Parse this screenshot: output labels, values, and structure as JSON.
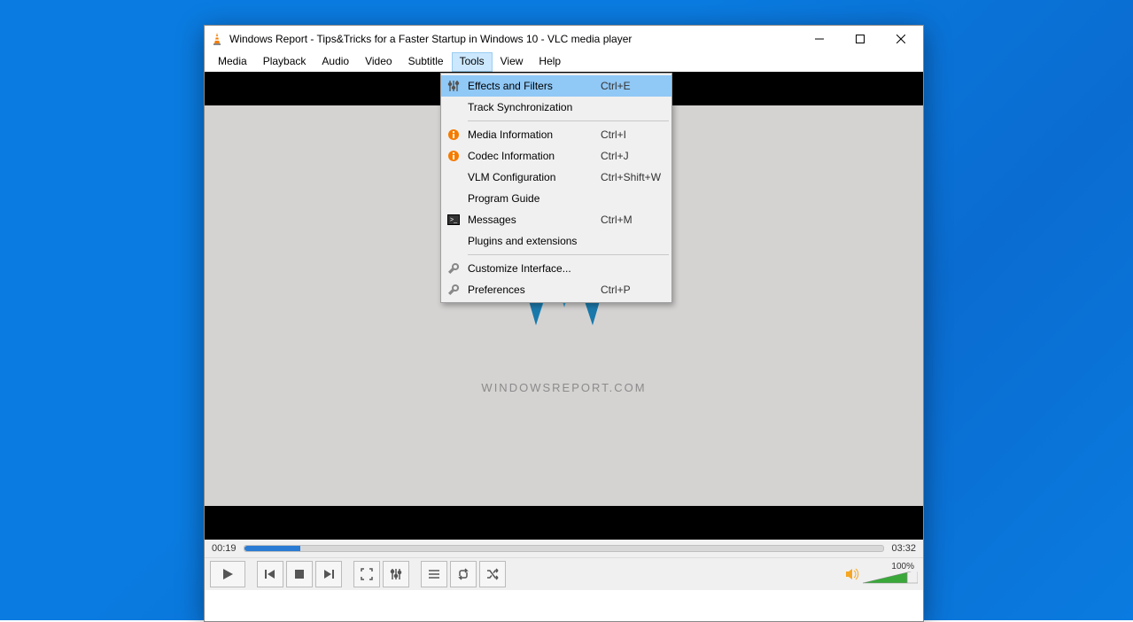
{
  "window": {
    "title": "Windows Report - Tips&Tricks for a Faster Startup in Windows 10 - VLC media player"
  },
  "menubar": [
    "Media",
    "Playback",
    "Audio",
    "Video",
    "Subtitle",
    "Tools",
    "View",
    "Help"
  ],
  "menubar_open_index": 5,
  "tools_menu": [
    {
      "icon": "sliders",
      "label": "Effects and Filters",
      "shortcut": "Ctrl+E",
      "highlight": true
    },
    {
      "icon": "",
      "label": "Track Synchronization",
      "shortcut": ""
    },
    {
      "sep": true
    },
    {
      "icon": "info",
      "label": "Media Information",
      "shortcut": "Ctrl+I"
    },
    {
      "icon": "info",
      "label": "Codec Information",
      "shortcut": "Ctrl+J"
    },
    {
      "icon": "",
      "label": "VLM Configuration",
      "shortcut": "Ctrl+Shift+W"
    },
    {
      "icon": "",
      "label": "Program Guide",
      "shortcut": ""
    },
    {
      "icon": "terminal",
      "label": "Messages",
      "shortcut": "Ctrl+M"
    },
    {
      "icon": "",
      "label": "Plugins and extensions",
      "shortcut": ""
    },
    {
      "sep": true
    },
    {
      "icon": "wrench",
      "label": "Customize Interface...",
      "shortcut": ""
    },
    {
      "icon": "wrench",
      "label": "Preferences",
      "shortcut": "Ctrl+P"
    }
  ],
  "video_frame": {
    "brand_text": "WINDOWSREPORT.COM"
  },
  "playback": {
    "elapsed": "00:19",
    "total": "03:32",
    "progress_pct": 8.8
  },
  "controls": [
    "play",
    "prev",
    "stop",
    "next",
    "fullscreen",
    "ext-settings",
    "playlist",
    "loop",
    "shuffle"
  ],
  "volume": {
    "percent_label": "100%",
    "muted": false
  }
}
